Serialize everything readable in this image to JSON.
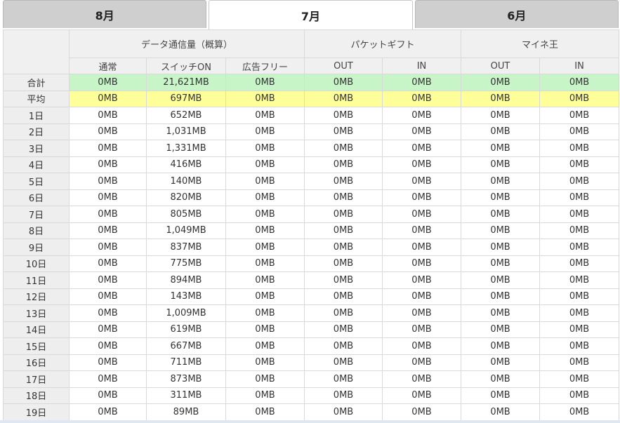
{
  "tabs": [
    {
      "label": "8月",
      "active": false
    },
    {
      "label": "7月",
      "active": true
    },
    {
      "label": "6月",
      "active": false
    }
  ],
  "groups": [
    {
      "label": "データ通信量（概算）",
      "span": 3
    },
    {
      "label": "パケットギフト",
      "span": 2
    },
    {
      "label": "マイネ王",
      "span": 2
    }
  ],
  "columns": [
    "通常",
    "スイッチON",
    "広告フリー",
    "OUT",
    "IN",
    "OUT",
    "IN"
  ],
  "rows": [
    {
      "label": "合計",
      "type": "total",
      "values": [
        "0MB",
        "21,621MB",
        "0MB",
        "0MB",
        "0MB",
        "0MB",
        "0MB"
      ]
    },
    {
      "label": "平均",
      "type": "avg",
      "values": [
        "0MB",
        "697MB",
        "0MB",
        "0MB",
        "0MB",
        "0MB",
        "0MB"
      ]
    },
    {
      "label": "1日",
      "type": "day",
      "values": [
        "0MB",
        "652MB",
        "0MB",
        "0MB",
        "0MB",
        "0MB",
        "0MB"
      ]
    },
    {
      "label": "2日",
      "type": "day",
      "values": [
        "0MB",
        "1,031MB",
        "0MB",
        "0MB",
        "0MB",
        "0MB",
        "0MB"
      ]
    },
    {
      "label": "3日",
      "type": "day",
      "values": [
        "0MB",
        "1,331MB",
        "0MB",
        "0MB",
        "0MB",
        "0MB",
        "0MB"
      ]
    },
    {
      "label": "4日",
      "type": "day",
      "values": [
        "0MB",
        "416MB",
        "0MB",
        "0MB",
        "0MB",
        "0MB",
        "0MB"
      ]
    },
    {
      "label": "5日",
      "type": "day",
      "values": [
        "0MB",
        "140MB",
        "0MB",
        "0MB",
        "0MB",
        "0MB",
        "0MB"
      ]
    },
    {
      "label": "6日",
      "type": "day",
      "values": [
        "0MB",
        "820MB",
        "0MB",
        "0MB",
        "0MB",
        "0MB",
        "0MB"
      ]
    },
    {
      "label": "7日",
      "type": "day",
      "values": [
        "0MB",
        "805MB",
        "0MB",
        "0MB",
        "0MB",
        "0MB",
        "0MB"
      ]
    },
    {
      "label": "8日",
      "type": "day",
      "values": [
        "0MB",
        "1,049MB",
        "0MB",
        "0MB",
        "0MB",
        "0MB",
        "0MB"
      ]
    },
    {
      "label": "9日",
      "type": "day",
      "values": [
        "0MB",
        "837MB",
        "0MB",
        "0MB",
        "0MB",
        "0MB",
        "0MB"
      ]
    },
    {
      "label": "10日",
      "type": "day",
      "values": [
        "0MB",
        "775MB",
        "0MB",
        "0MB",
        "0MB",
        "0MB",
        "0MB"
      ]
    },
    {
      "label": "11日",
      "type": "day",
      "values": [
        "0MB",
        "894MB",
        "0MB",
        "0MB",
        "0MB",
        "0MB",
        "0MB"
      ]
    },
    {
      "label": "12日",
      "type": "day",
      "values": [
        "0MB",
        "143MB",
        "0MB",
        "0MB",
        "0MB",
        "0MB",
        "0MB"
      ]
    },
    {
      "label": "13日",
      "type": "day",
      "values": [
        "0MB",
        "1,009MB",
        "0MB",
        "0MB",
        "0MB",
        "0MB",
        "0MB"
      ]
    },
    {
      "label": "14日",
      "type": "day",
      "values": [
        "0MB",
        "619MB",
        "0MB",
        "0MB",
        "0MB",
        "0MB",
        "0MB"
      ]
    },
    {
      "label": "15日",
      "type": "day",
      "values": [
        "0MB",
        "667MB",
        "0MB",
        "0MB",
        "0MB",
        "0MB",
        "0MB"
      ]
    },
    {
      "label": "16日",
      "type": "day",
      "values": [
        "0MB",
        "711MB",
        "0MB",
        "0MB",
        "0MB",
        "0MB",
        "0MB"
      ]
    },
    {
      "label": "17日",
      "type": "day",
      "values": [
        "0MB",
        "873MB",
        "0MB",
        "0MB",
        "0MB",
        "0MB",
        "0MB"
      ]
    },
    {
      "label": "18日",
      "type": "day",
      "values": [
        "0MB",
        "311MB",
        "0MB",
        "0MB",
        "0MB",
        "0MB",
        "0MB"
      ]
    },
    {
      "label": "19日",
      "type": "day",
      "values": [
        "0MB",
        "89MB",
        "0MB",
        "0MB",
        "0MB",
        "0MB",
        "0MB"
      ]
    }
  ],
  "colors": {
    "total_row": "#c8f5c8",
    "avg_row": "#ffff99",
    "header_bg": "#f0f0f0",
    "tab_inactive": "#cfcfcf",
    "tab_active": "#ffffff"
  }
}
